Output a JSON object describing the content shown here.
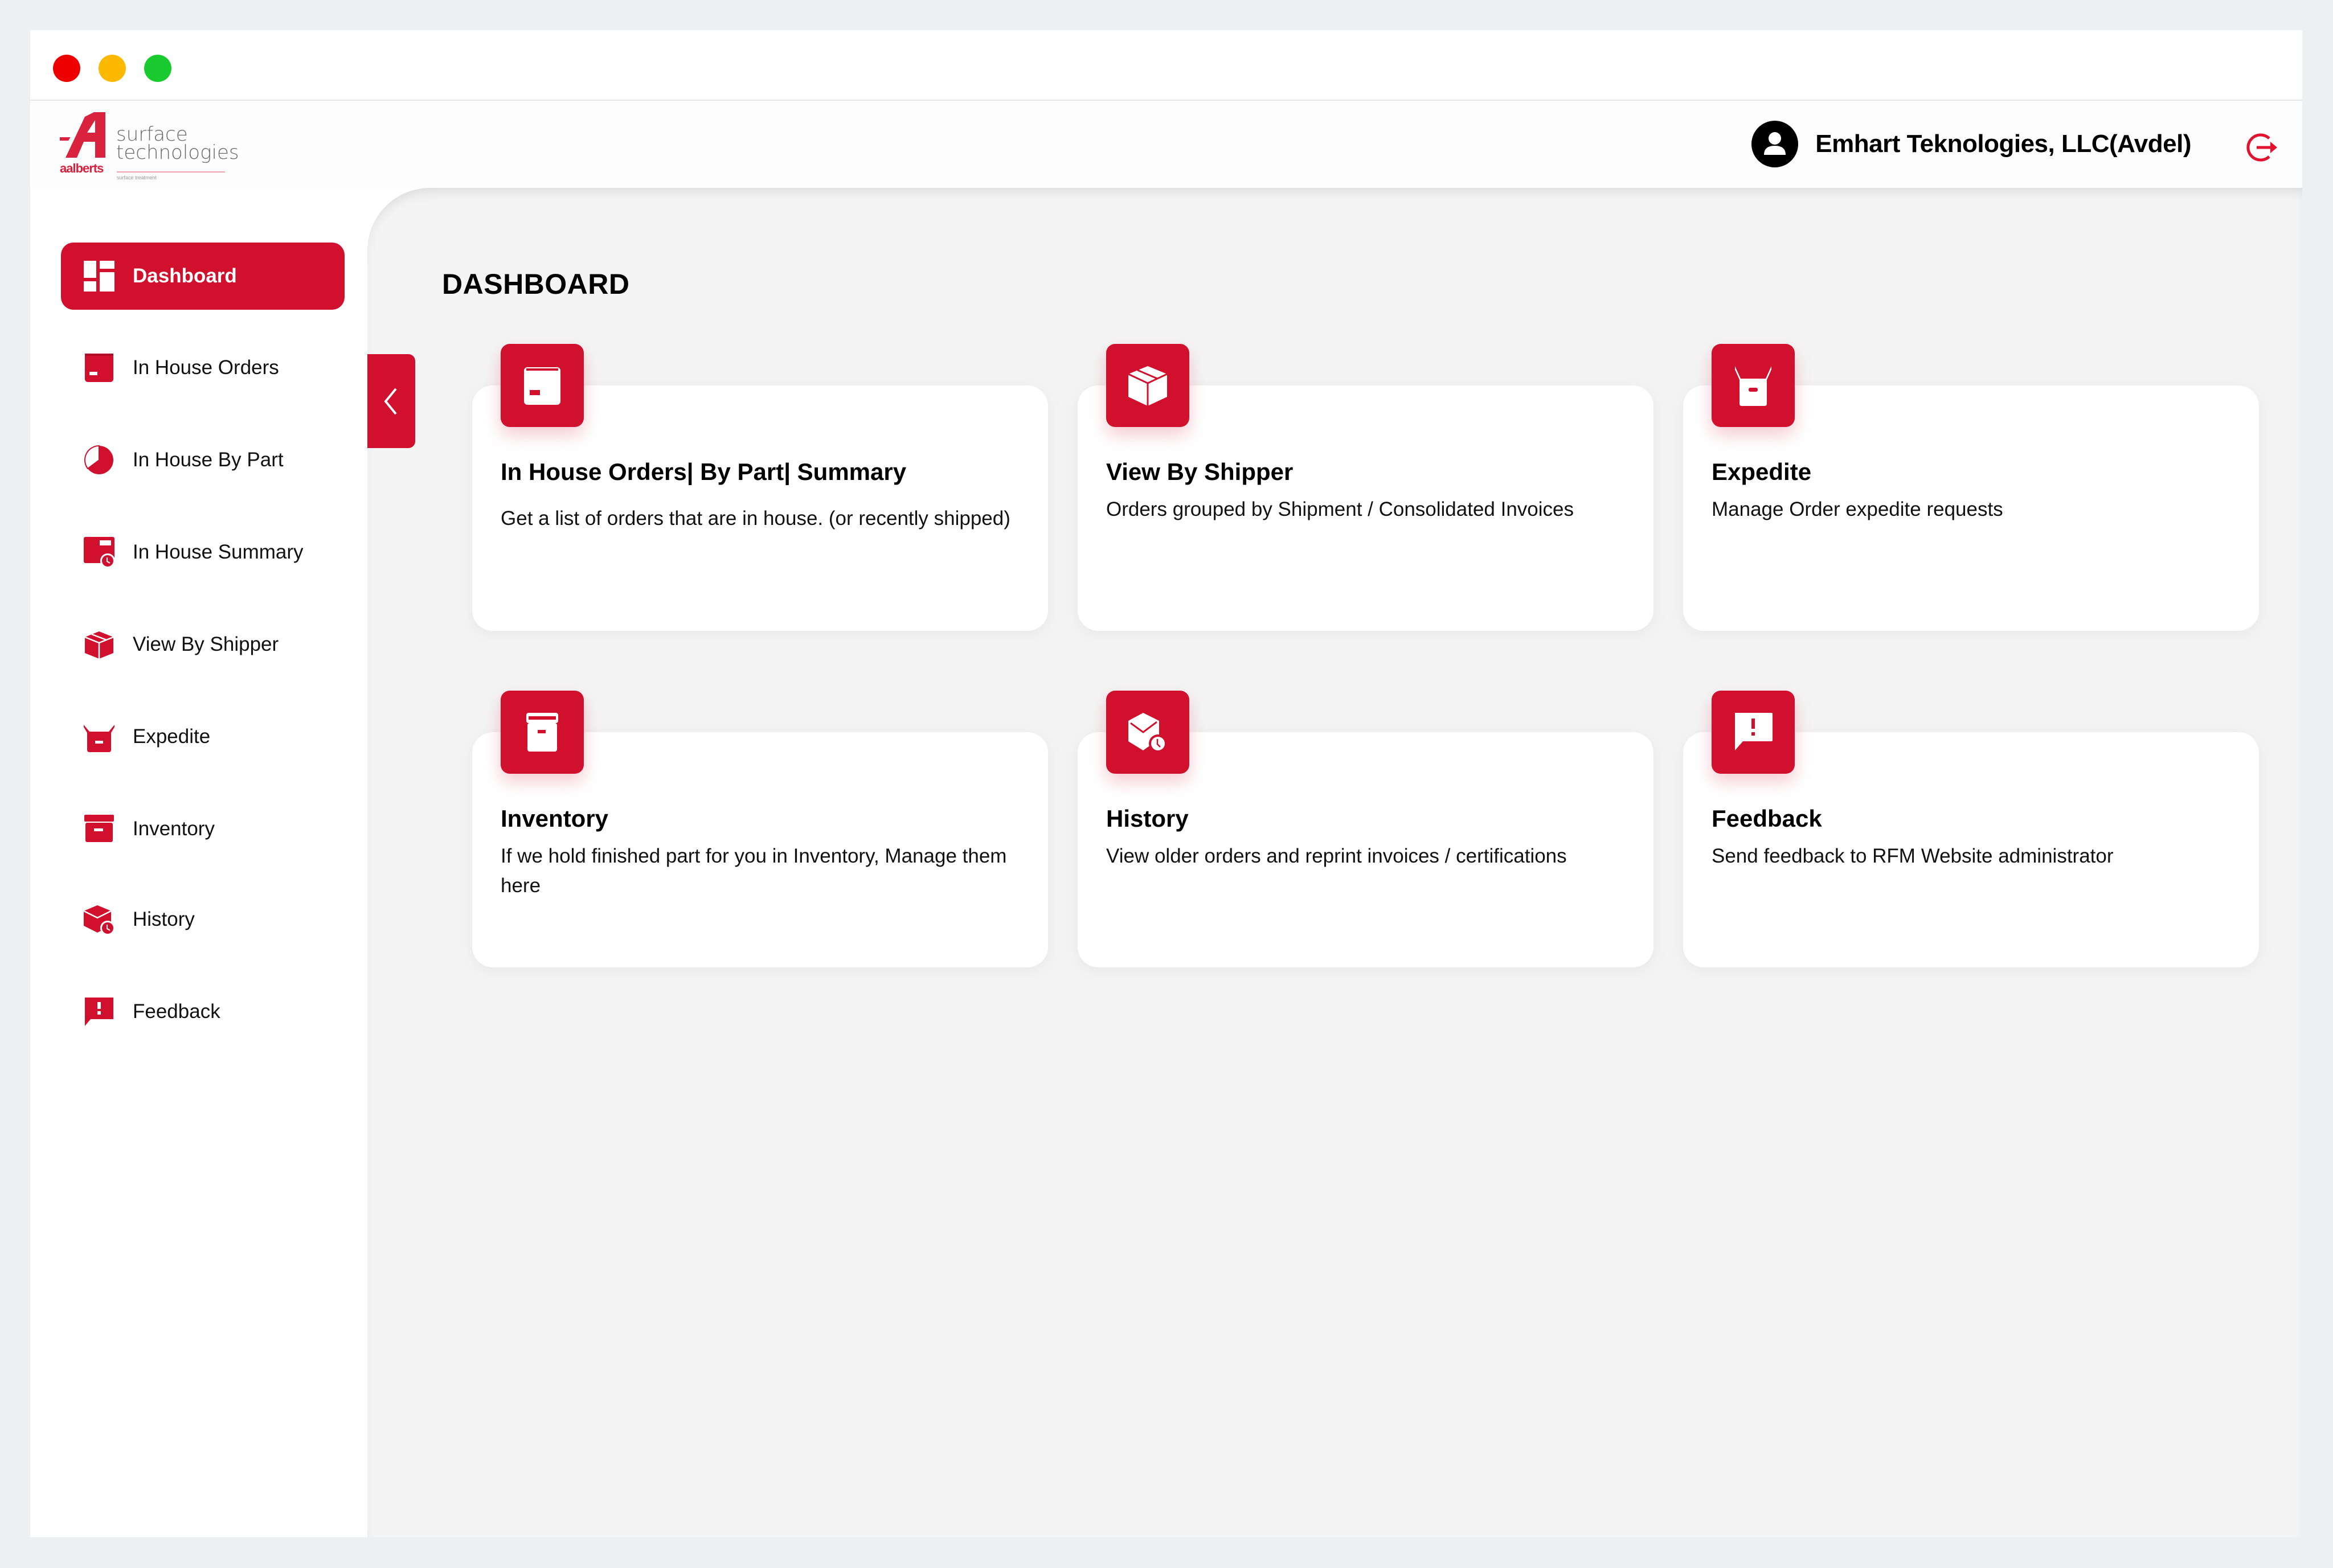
{
  "window": {
    "controls": [
      "close",
      "minimize",
      "maximize"
    ]
  },
  "brand": {
    "name_line1": "surface",
    "name_line2": "technologies",
    "parent": "aalberts",
    "tagline": "surface treatment",
    "accent_color": "#d0102c"
  },
  "header": {
    "user_name": "Emhart Teknologies, LLC(Avdel)",
    "user_icon": "user-avatar-icon",
    "logout_icon": "logout-icon"
  },
  "sidebar": {
    "items": [
      {
        "label": "Dashboard",
        "icon": "dashboard-icon",
        "active": true
      },
      {
        "label": "In House Orders",
        "icon": "box-icon",
        "active": false
      },
      {
        "label": "In House By Part",
        "icon": "pie-chart-icon",
        "active": false
      },
      {
        "label": "In House Summary",
        "icon": "box-clock-icon",
        "active": false
      },
      {
        "label": "View By Shipper",
        "icon": "package-icon",
        "active": false
      },
      {
        "label": "Expedite",
        "icon": "basket-icon",
        "active": false
      },
      {
        "label": "Inventory",
        "icon": "archive-icon",
        "active": false
      },
      {
        "label": "History",
        "icon": "package-clock-icon",
        "active": false
      },
      {
        "label": "Feedback",
        "icon": "feedback-icon",
        "active": false
      }
    ],
    "collapse_icon": "chevron-left-icon"
  },
  "main": {
    "title": "DASHBOARD",
    "cards": [
      {
        "title": "In House Orders| By Part| Summary",
        "description": "Get a list of orders that are in house. (or recently shipped)",
        "icon": "box-icon"
      },
      {
        "title": "View By Shipper",
        "description": "Orders grouped by Shipment / Consolidated Invoices",
        "icon": "package-icon"
      },
      {
        "title": "Expedite",
        "description": "Manage Order expedite requests",
        "icon": "basket-icon"
      },
      {
        "title": "Inventory",
        "description": "If we hold finished part for you in Inventory, Manage them here",
        "icon": "archive-icon"
      },
      {
        "title": "History",
        "description": "View older orders and reprint invoices / certifications",
        "icon": "package-clock-icon"
      },
      {
        "title": "Feedback",
        "description": "Send feedback to RFM Website administrator",
        "icon": "feedback-icon"
      }
    ]
  }
}
